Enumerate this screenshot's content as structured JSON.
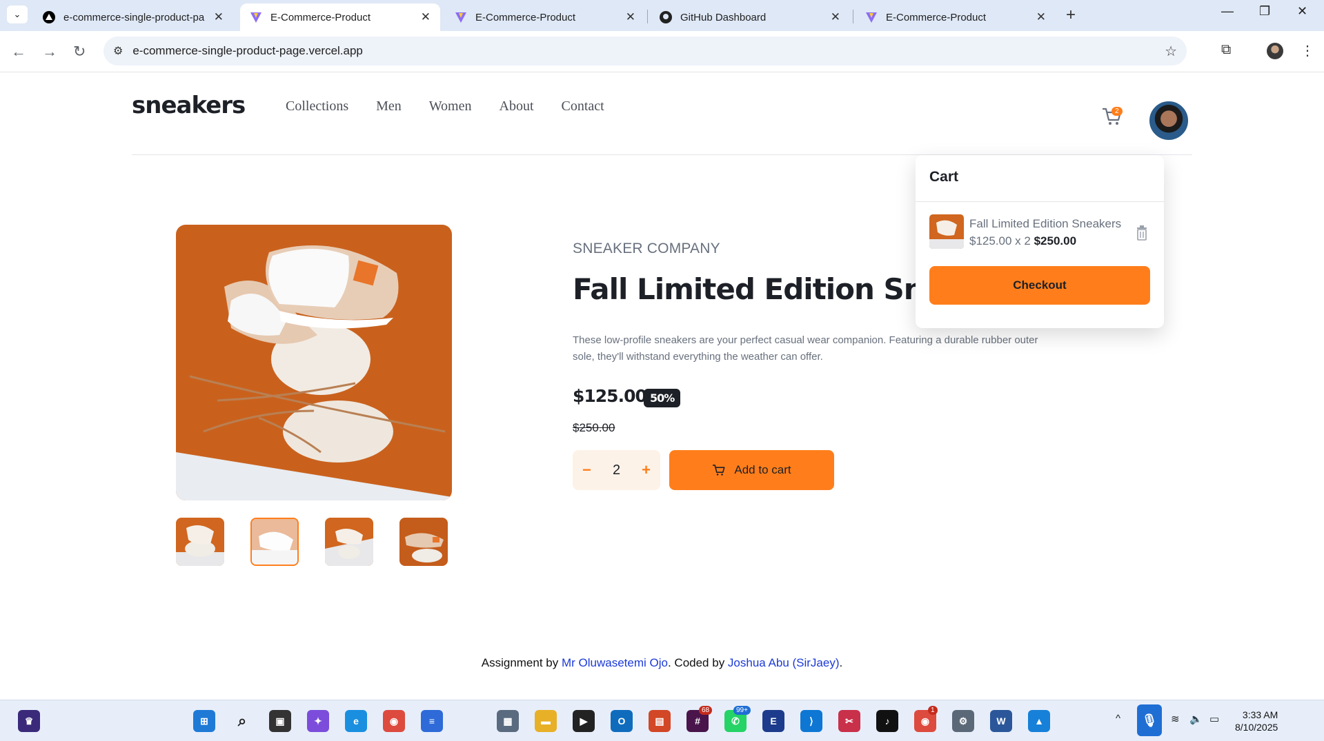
{
  "browser": {
    "tabs": [
      {
        "title": "e-commerce-single-product-pa",
        "icon": "vercel-icon",
        "active": false
      },
      {
        "title": "E-Commerce-Product",
        "icon": "vite-icon",
        "active": true
      },
      {
        "title": "E-Commerce-Product",
        "icon": "vite-icon",
        "active": false
      },
      {
        "title": "GitHub Dashboard",
        "icon": "github-icon",
        "active": false
      },
      {
        "title": "E-Commerce-Product",
        "icon": "vite-icon",
        "active": false
      }
    ],
    "url": "e-commerce-single-product-page.vercel.app"
  },
  "header": {
    "logo": "sneakers",
    "nav": [
      "Collections",
      "Men",
      "Women",
      "About",
      "Contact"
    ],
    "cart_count": "2"
  },
  "product": {
    "company": "SNEAKER COMPANY",
    "title": "Fall Limited Edition Sneakers",
    "description": "These low-profile sneakers are your perfect casual wear companion. Featuring a durable rubber outer sole, they'll withstand everything the weather can offer.",
    "price": "$125.00",
    "discount": "50%",
    "old_price": "$250.00",
    "quantity": "2",
    "add_to_cart": "Add to cart",
    "selected_thumbnail": 2
  },
  "cart": {
    "title": "Cart",
    "item_name": "Fall Limited Edition Sneakers",
    "item_unit": "$125.00 x 2",
    "item_total": "$250.00",
    "checkout": "Checkout"
  },
  "footer": {
    "prefix": "Assignment by ",
    "author1": "Mr Oluwasetemi Ojo",
    "middle": ". Coded by ",
    "author2": "Joshua Abu (SirJaey)",
    "suffix": "."
  },
  "taskbar": {
    "time": "3:33 AM",
    "date": "8/10/2025",
    "badges": {
      "slack": "68",
      "whatsapp": "99+",
      "chrome": "1"
    }
  },
  "colors": {
    "accent": "#ff7e1b",
    "dark": "#1d2026",
    "gray": "#68707d",
    "pale": "#fdf2e8"
  }
}
